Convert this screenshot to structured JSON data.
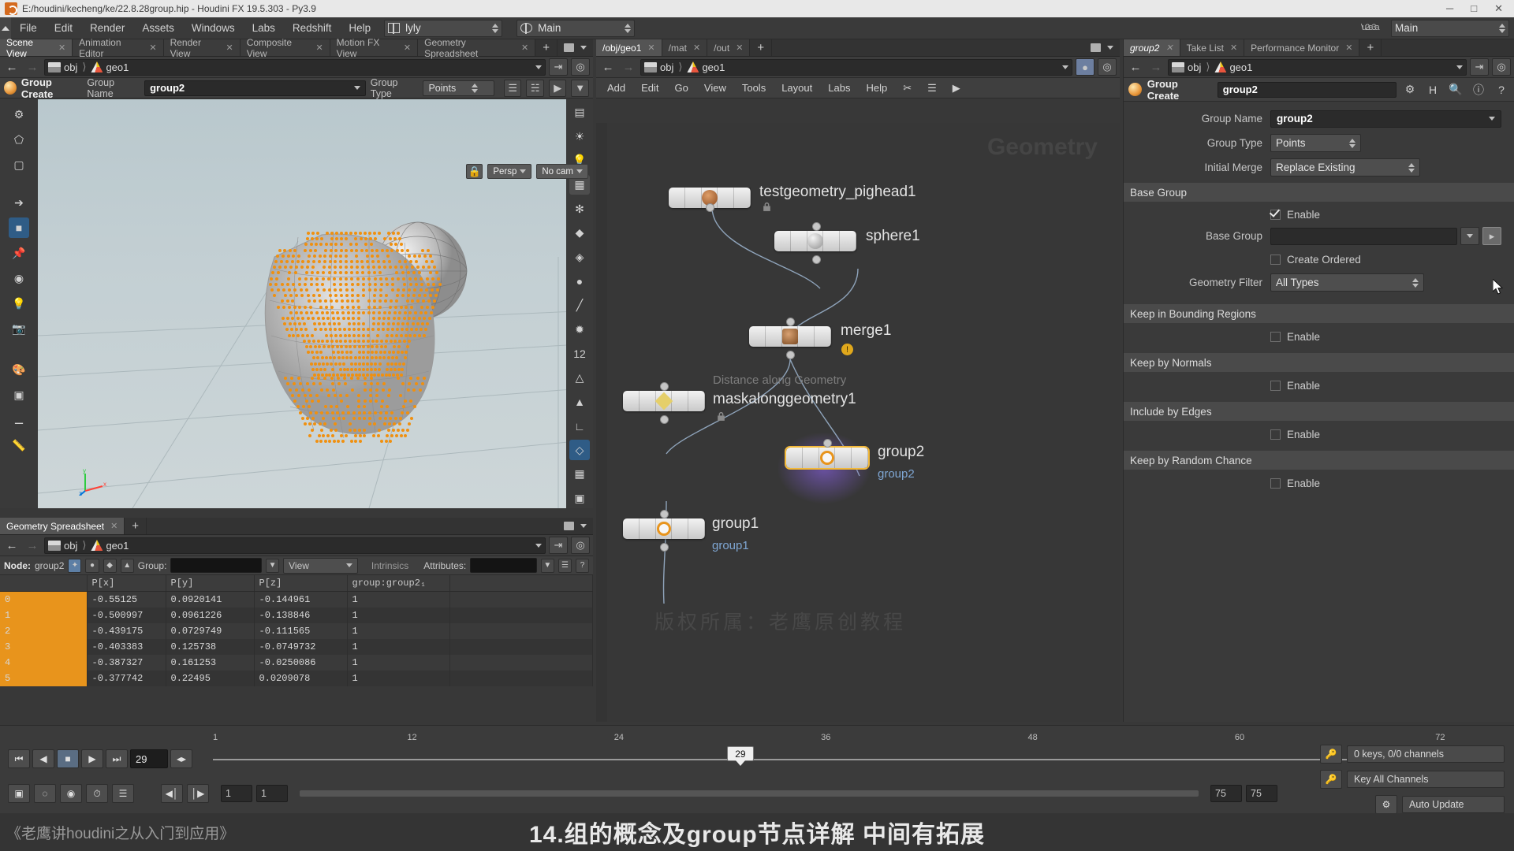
{
  "window": {
    "title": "E:/houdini/kecheng/ke/22.8.28group.hip - Houdini FX 19.5.303 - Py3.9",
    "minimize": "─",
    "maximize": "□",
    "close": "✕"
  },
  "menubar": {
    "items": [
      "File",
      "Edit",
      "Render",
      "Assets",
      "Windows",
      "Labs",
      "Redshift",
      "Help"
    ],
    "desktop": "lyly",
    "pane": "Main",
    "right_desktop": "Main"
  },
  "scene_view": {
    "tabs": [
      {
        "label": "Scene View",
        "active": true
      },
      {
        "label": "Animation Editor",
        "active": false
      },
      {
        "label": "Render View",
        "active": false
      },
      {
        "label": "Composite View",
        "active": false
      },
      {
        "label": "Motion FX View",
        "active": false
      },
      {
        "label": "Geometry Spreadsheet",
        "active": false
      }
    ],
    "add_tab": "+",
    "path": {
      "obj": "obj",
      "geo": "geo1"
    },
    "op_title": "Group Create",
    "group_name_label": "Group Name",
    "group_name_value": "group2",
    "group_type_label": "Group Type",
    "group_type_value": "Points",
    "viewport": {
      "lock_icon": "lock-icon",
      "persp": "Persp",
      "camera": "No cam",
      "axis_x": "x",
      "axis_y": "y",
      "axis_z": "z"
    }
  },
  "spreadsheet": {
    "tabs": [
      {
        "label": "Geometry Spreadsheet",
        "active": true
      }
    ],
    "add_tab": "+",
    "path": {
      "obj": "obj",
      "geo": "geo1"
    },
    "node_label": "Node:",
    "node_value": "group2",
    "group_label": "Group:",
    "group_value": "",
    "view_label": "View",
    "intrinsics_label": "Intrinsics",
    "attributes_label": "Attributes:",
    "columns": [
      "",
      "P[x]",
      "P[y]",
      "P[z]",
      "group:group2₁",
      ""
    ],
    "rows": [
      {
        "idx": "0",
        "px": "-0.55125",
        "py": "0.0920141",
        "pz": "-0.144961",
        "grp": "1"
      },
      {
        "idx": "1",
        "px": "-0.500997",
        "py": "0.0961226",
        "pz": "-0.138846",
        "grp": "1"
      },
      {
        "idx": "2",
        "px": "-0.439175",
        "py": "0.0729749",
        "pz": "-0.111565",
        "grp": "1"
      },
      {
        "idx": "3",
        "px": "-0.403383",
        "py": "0.125738",
        "pz": "-0.0749732",
        "grp": "1"
      },
      {
        "idx": "4",
        "px": "-0.387327",
        "py": "0.161253",
        "pz": "-0.0250086",
        "grp": "1"
      },
      {
        "idx": "5",
        "px": "-0.377742",
        "py": "0.22495",
        "pz": "0.0209078",
        "grp": "1"
      }
    ]
  },
  "network": {
    "tabs": [
      {
        "label": "/obj/geo1",
        "active": true
      },
      {
        "label": "/mat",
        "active": false
      },
      {
        "label": "/out",
        "active": false
      }
    ],
    "add_tab": "+",
    "path": {
      "obj": "obj",
      "geo": "geo1"
    },
    "menu": [
      "Add",
      "Edit",
      "Go",
      "View",
      "Tools",
      "Layout",
      "Labs",
      "Help"
    ],
    "watermark": "Geometry",
    "nodes": [
      {
        "name": "testgeometry_pighead1",
        "type": "",
        "sublabel": "",
        "selected": false
      },
      {
        "name": "sphere1",
        "type": "",
        "sublabel": "",
        "selected": false
      },
      {
        "name": "merge1",
        "type": "",
        "sublabel": "",
        "selected": false
      },
      {
        "name": "maskalonggeometry1",
        "type": "Distance along Geometry",
        "sublabel": "",
        "selected": false
      },
      {
        "name": "group2",
        "type": "",
        "sublabel": "group2",
        "selected": true
      },
      {
        "name": "group1",
        "type": "",
        "sublabel": "group1",
        "selected": false
      }
    ]
  },
  "params": {
    "tabs": [
      {
        "label": "group2",
        "active": true
      },
      {
        "label": "Take List",
        "active": false
      },
      {
        "label": "Performance Monitor",
        "active": false
      }
    ],
    "add_tab": "+",
    "path": {
      "obj": "obj",
      "geo": "geo1"
    },
    "op_title": "Group Create",
    "op_name": "group2",
    "rows": [
      {
        "label": "Group Name",
        "type": "text",
        "value": "group2"
      },
      {
        "label": "Group Type",
        "type": "combo",
        "value": "Points"
      },
      {
        "label": "Initial Merge",
        "type": "combo",
        "value": "Replace Existing"
      }
    ],
    "sections": [
      {
        "title": "Base Group",
        "enable_label": "Enable",
        "enable_checked": true,
        "fields": [
          {
            "label": "Base Group",
            "type": "field",
            "value": ""
          },
          {
            "label": "",
            "type": "check",
            "value": "Create Ordered",
            "checked": false
          },
          {
            "label": "Geometry Filter",
            "type": "combo",
            "value": "All Types"
          }
        ]
      },
      {
        "title": "Keep in Bounding Regions",
        "enable_label": "Enable",
        "enable_checked": false,
        "fields": []
      },
      {
        "title": "Keep by Normals",
        "enable_label": "Enable",
        "enable_checked": false,
        "fields": []
      },
      {
        "title": "Include by Edges",
        "enable_label": "Enable",
        "enable_checked": false,
        "fields": []
      },
      {
        "title": "Keep by Random Chance",
        "enable_label": "Enable",
        "enable_checked": false,
        "fields": []
      }
    ]
  },
  "timeline": {
    "ticks": [
      "1",
      "12",
      "24",
      "36",
      "48",
      "60",
      "72"
    ],
    "current_frame": "29",
    "playhead_frame": "29",
    "range_start": "1",
    "range_end": "1",
    "range_right_1": "75",
    "range_right_2": "75",
    "keys_status": "0 keys, 0/0 channels",
    "key_all_channels": "Key All Channels",
    "auto_update": "Auto Update"
  },
  "overlay": {
    "left_text": "《老鹰讲houdini之从入门到应用》",
    "center_text": "14.组的概念及group节点详解 中间有拓展",
    "watermark": "版权所属：老鹰原创教程"
  },
  "colors": {
    "accent_orange": "#e8941c",
    "node_select": "#f3b93a",
    "panel_bg": "#3a3a3a"
  }
}
